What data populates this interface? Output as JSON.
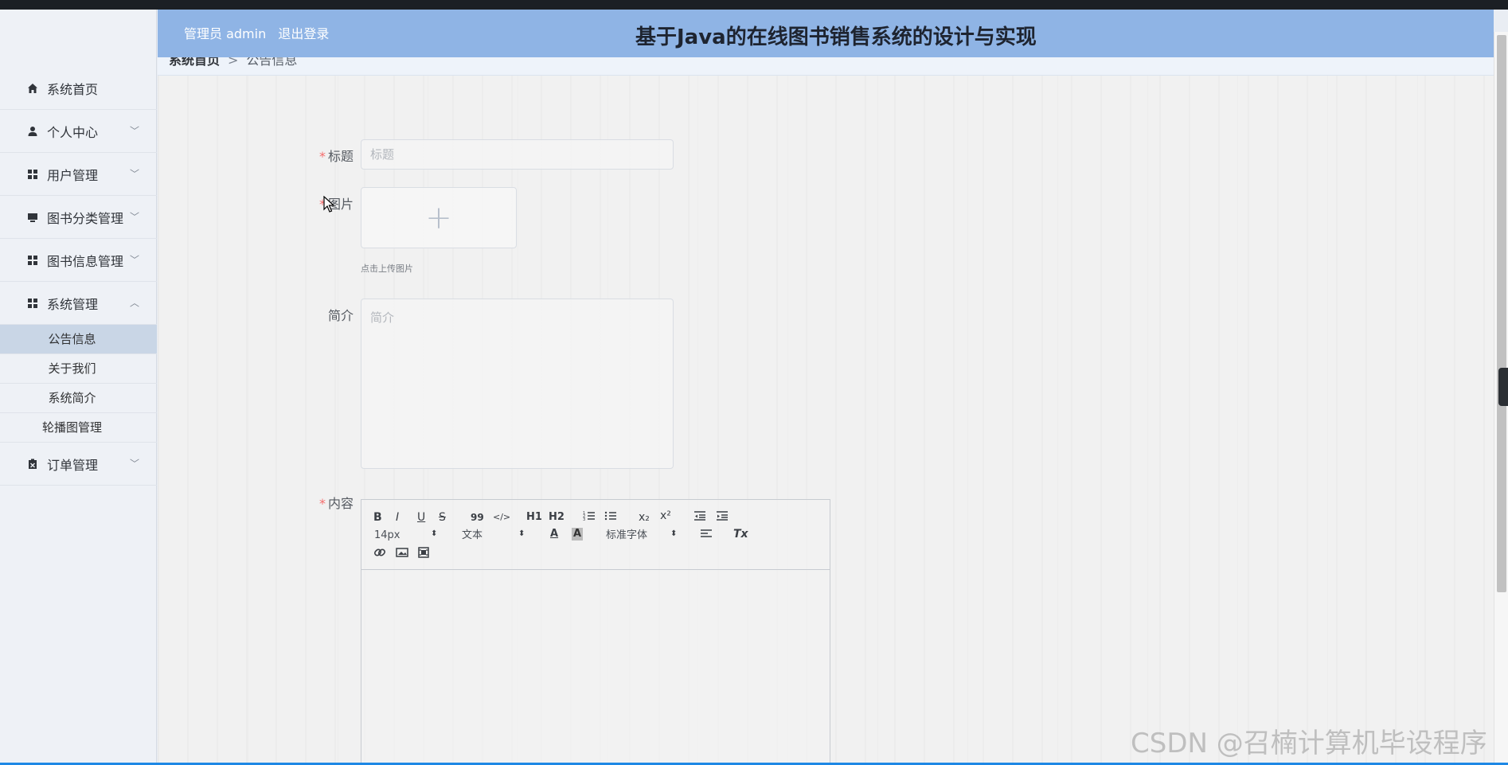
{
  "header": {
    "user_label": "管理员 admin",
    "logout_label": "退出登录",
    "title": "基于Java的在线图书销售系统的设计与实现"
  },
  "breadcrumb": {
    "home": "系统首页",
    "separator": ">",
    "current": "公告信息"
  },
  "sidebar": {
    "items": [
      {
        "label": "系统首页",
        "icon": "home-icon"
      },
      {
        "label": "个人中心",
        "icon": "user-icon"
      },
      {
        "label": "用户管理",
        "icon": "grid-icon"
      },
      {
        "label": "图书分类管理",
        "icon": "monitor-icon"
      },
      {
        "label": "图书信息管理",
        "icon": "grid-icon"
      },
      {
        "label": "系统管理",
        "icon": "grid-icon"
      },
      {
        "label": "订单管理",
        "icon": "clipboard-icon"
      }
    ],
    "subitems": [
      {
        "label": "公告信息",
        "active": true
      },
      {
        "label": "关于我们"
      },
      {
        "label": "系统简介"
      },
      {
        "label": "轮播图管理"
      }
    ]
  },
  "form": {
    "title_label": "标题",
    "title_placeholder": "标题",
    "image_label": "图片",
    "upload_plus": "+",
    "upload_tip": "点击上传图片",
    "intro_label": "简介",
    "intro_placeholder": "简介",
    "content_label": "内容",
    "required_mark": "*"
  },
  "editor": {
    "row1": [
      "B",
      "I",
      "U",
      "S",
      "99",
      "</>",
      "H1",
      "H2",
      "OL",
      "UL",
      "x₂",
      "x²",
      "outdent",
      "indent"
    ],
    "size_value": "14px",
    "header_value": "文本",
    "font_value": "标准字体",
    "clean_label": "Tx"
  },
  "watermark": "CSDN @召楠计算机毕设程序"
}
